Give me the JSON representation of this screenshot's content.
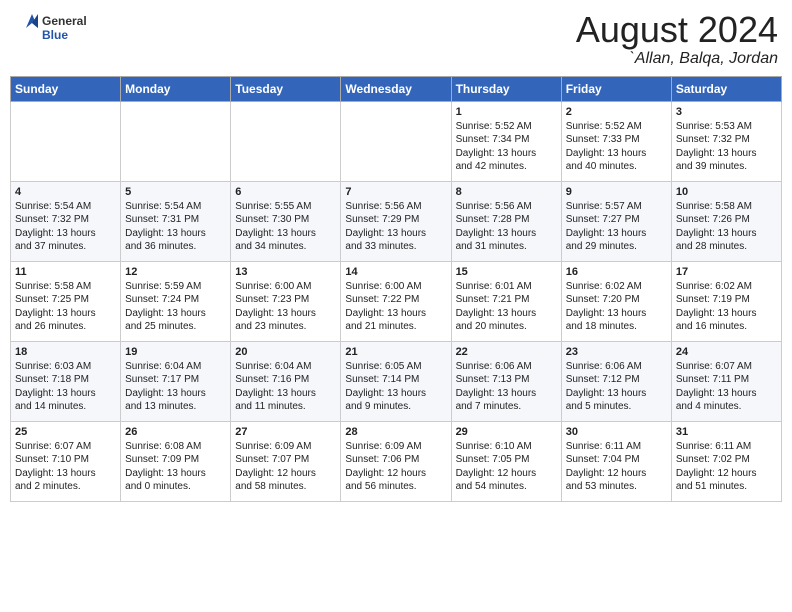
{
  "header": {
    "logo_general": "General",
    "logo_blue": "Blue",
    "month_title": "August 2024",
    "location": "`Allan, Balqa, Jordan"
  },
  "weekdays": [
    "Sunday",
    "Monday",
    "Tuesday",
    "Wednesday",
    "Thursday",
    "Friday",
    "Saturday"
  ],
  "weeks": [
    [
      {
        "day": "",
        "info": ""
      },
      {
        "day": "",
        "info": ""
      },
      {
        "day": "",
        "info": ""
      },
      {
        "day": "",
        "info": ""
      },
      {
        "day": "1",
        "info": "Sunrise: 5:52 AM\nSunset: 7:34 PM\nDaylight: 13 hours\nand 42 minutes."
      },
      {
        "day": "2",
        "info": "Sunrise: 5:52 AM\nSunset: 7:33 PM\nDaylight: 13 hours\nand 40 minutes."
      },
      {
        "day": "3",
        "info": "Sunrise: 5:53 AM\nSunset: 7:32 PM\nDaylight: 13 hours\nand 39 minutes."
      }
    ],
    [
      {
        "day": "4",
        "info": "Sunrise: 5:54 AM\nSunset: 7:32 PM\nDaylight: 13 hours\nand 37 minutes."
      },
      {
        "day": "5",
        "info": "Sunrise: 5:54 AM\nSunset: 7:31 PM\nDaylight: 13 hours\nand 36 minutes."
      },
      {
        "day": "6",
        "info": "Sunrise: 5:55 AM\nSunset: 7:30 PM\nDaylight: 13 hours\nand 34 minutes."
      },
      {
        "day": "7",
        "info": "Sunrise: 5:56 AM\nSunset: 7:29 PM\nDaylight: 13 hours\nand 33 minutes."
      },
      {
        "day": "8",
        "info": "Sunrise: 5:56 AM\nSunset: 7:28 PM\nDaylight: 13 hours\nand 31 minutes."
      },
      {
        "day": "9",
        "info": "Sunrise: 5:57 AM\nSunset: 7:27 PM\nDaylight: 13 hours\nand 29 minutes."
      },
      {
        "day": "10",
        "info": "Sunrise: 5:58 AM\nSunset: 7:26 PM\nDaylight: 13 hours\nand 28 minutes."
      }
    ],
    [
      {
        "day": "11",
        "info": "Sunrise: 5:58 AM\nSunset: 7:25 PM\nDaylight: 13 hours\nand 26 minutes."
      },
      {
        "day": "12",
        "info": "Sunrise: 5:59 AM\nSunset: 7:24 PM\nDaylight: 13 hours\nand 25 minutes."
      },
      {
        "day": "13",
        "info": "Sunrise: 6:00 AM\nSunset: 7:23 PM\nDaylight: 13 hours\nand 23 minutes."
      },
      {
        "day": "14",
        "info": "Sunrise: 6:00 AM\nSunset: 7:22 PM\nDaylight: 13 hours\nand 21 minutes."
      },
      {
        "day": "15",
        "info": "Sunrise: 6:01 AM\nSunset: 7:21 PM\nDaylight: 13 hours\nand 20 minutes."
      },
      {
        "day": "16",
        "info": "Sunrise: 6:02 AM\nSunset: 7:20 PM\nDaylight: 13 hours\nand 18 minutes."
      },
      {
        "day": "17",
        "info": "Sunrise: 6:02 AM\nSunset: 7:19 PM\nDaylight: 13 hours\nand 16 minutes."
      }
    ],
    [
      {
        "day": "18",
        "info": "Sunrise: 6:03 AM\nSunset: 7:18 PM\nDaylight: 13 hours\nand 14 minutes."
      },
      {
        "day": "19",
        "info": "Sunrise: 6:04 AM\nSunset: 7:17 PM\nDaylight: 13 hours\nand 13 minutes."
      },
      {
        "day": "20",
        "info": "Sunrise: 6:04 AM\nSunset: 7:16 PM\nDaylight: 13 hours\nand 11 minutes."
      },
      {
        "day": "21",
        "info": "Sunrise: 6:05 AM\nSunset: 7:14 PM\nDaylight: 13 hours\nand 9 minutes."
      },
      {
        "day": "22",
        "info": "Sunrise: 6:06 AM\nSunset: 7:13 PM\nDaylight: 13 hours\nand 7 minutes."
      },
      {
        "day": "23",
        "info": "Sunrise: 6:06 AM\nSunset: 7:12 PM\nDaylight: 13 hours\nand 5 minutes."
      },
      {
        "day": "24",
        "info": "Sunrise: 6:07 AM\nSunset: 7:11 PM\nDaylight: 13 hours\nand 4 minutes."
      }
    ],
    [
      {
        "day": "25",
        "info": "Sunrise: 6:07 AM\nSunset: 7:10 PM\nDaylight: 13 hours\nand 2 minutes."
      },
      {
        "day": "26",
        "info": "Sunrise: 6:08 AM\nSunset: 7:09 PM\nDaylight: 13 hours\nand 0 minutes."
      },
      {
        "day": "27",
        "info": "Sunrise: 6:09 AM\nSunset: 7:07 PM\nDaylight: 12 hours\nand 58 minutes."
      },
      {
        "day": "28",
        "info": "Sunrise: 6:09 AM\nSunset: 7:06 PM\nDaylight: 12 hours\nand 56 minutes."
      },
      {
        "day": "29",
        "info": "Sunrise: 6:10 AM\nSunset: 7:05 PM\nDaylight: 12 hours\nand 54 minutes."
      },
      {
        "day": "30",
        "info": "Sunrise: 6:11 AM\nSunset: 7:04 PM\nDaylight: 12 hours\nand 53 minutes."
      },
      {
        "day": "31",
        "info": "Sunrise: 6:11 AM\nSunset: 7:02 PM\nDaylight: 12 hours\nand 51 minutes."
      }
    ]
  ]
}
